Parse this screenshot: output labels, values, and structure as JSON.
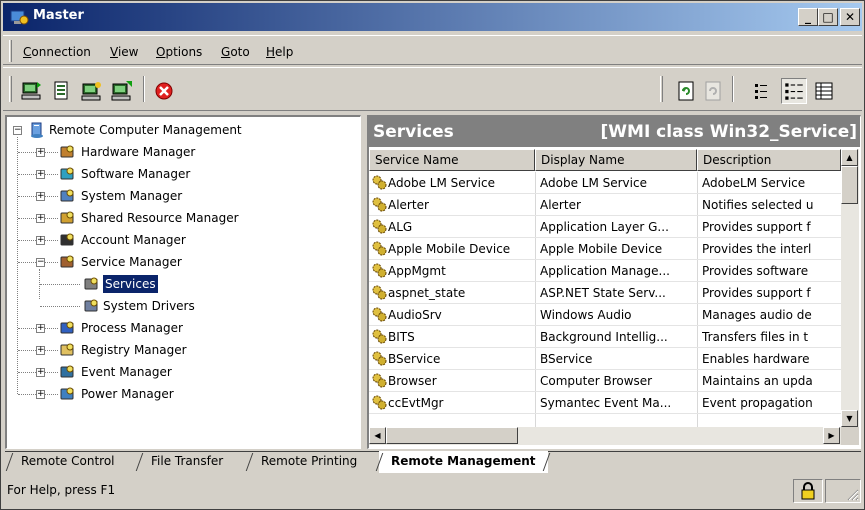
{
  "window": {
    "title": "Master"
  },
  "menu": [
    {
      "id": "connection",
      "accel": "C",
      "rest": "onnection"
    },
    {
      "id": "view",
      "accel": "V",
      "rest": "iew"
    },
    {
      "id": "options",
      "accel": "O",
      "rest": "ptions"
    },
    {
      "id": "goto",
      "accel": "G",
      "rest": "oto"
    },
    {
      "id": "help",
      "accel": "H",
      "rest": "elp"
    }
  ],
  "toolbar": {
    "left_icons": [
      "connect-icon",
      "computer-info-icon",
      "refresh-remote-icon",
      "properties-icon",
      "disconnect-icon"
    ],
    "right_icons": [
      "refresh-icon",
      "stop-refresh-icon",
      "list-view-icon",
      "detail-view-icon",
      "grid-view-icon"
    ]
  },
  "tree": {
    "root": "Remote Computer Management",
    "items": [
      {
        "label": "Hardware Manager",
        "icon": "hardware-icon",
        "expander": "+"
      },
      {
        "label": "Software Manager",
        "icon": "software-icon",
        "expander": "+"
      },
      {
        "label": "System Manager",
        "icon": "system-icon",
        "expander": "+"
      },
      {
        "label": "Shared Resource Manager",
        "icon": "shared-folder-icon",
        "expander": "+"
      },
      {
        "label": "Account Manager",
        "icon": "users-icon",
        "expander": "+"
      },
      {
        "label": "Service Manager",
        "icon": "services-icon",
        "expander": "−"
      },
      {
        "label": "Services",
        "icon": "gears-icon",
        "child": true,
        "selected": true
      },
      {
        "label": "System Drivers",
        "icon": "driver-icon",
        "child": true
      },
      {
        "label": "Process Manager",
        "icon": "process-icon",
        "expander": "+"
      },
      {
        "label": "Registry Manager",
        "icon": "registry-icon",
        "expander": "+"
      },
      {
        "label": "Event Manager",
        "icon": "event-icon",
        "expander": "+"
      },
      {
        "label": "Power Manager",
        "icon": "power-icon",
        "expander": "+"
      }
    ]
  },
  "panel": {
    "title": "Services",
    "subtitle": "[WMI class Win32_Service]",
    "columns": [
      "Service Name",
      "Display Name",
      "Description"
    ],
    "rows": [
      [
        "Adobe LM Service",
        "Adobe LM Service",
        "AdobeLM Service"
      ],
      [
        "Alerter",
        "Alerter",
        "Notifies selected u"
      ],
      [
        "ALG",
        "Application Layer G...",
        "Provides support f"
      ],
      [
        "Apple Mobile Device",
        "Apple Mobile Device",
        "Provides the interl"
      ],
      [
        "AppMgmt",
        "Application Manage...",
        "Provides software"
      ],
      [
        "aspnet_state",
        "ASP.NET State Serv...",
        "Provides support f"
      ],
      [
        "AudioSrv",
        "Windows Audio",
        "Manages audio de"
      ],
      [
        "BITS",
        "Background Intellig...",
        "Transfers files in t"
      ],
      [
        "BService",
        "BService",
        "Enables hardware"
      ],
      [
        "Browser",
        "Computer Browser",
        "Maintains an upda"
      ],
      [
        "ccEvtMgr",
        "Symantec Event Ma...",
        "Event propagation"
      ]
    ]
  },
  "tabs": [
    "Remote Control",
    "File Transfer",
    "Remote Printing",
    "Remote Management"
  ],
  "active_tab": "Remote Management",
  "status": {
    "text": "For Help, press F1",
    "icon": "lock-icon"
  },
  "colors": {
    "title_start": "#0a246a",
    "title_end": "#a6caf0",
    "selection": "#0a246a",
    "panel_head": "#808080"
  }
}
